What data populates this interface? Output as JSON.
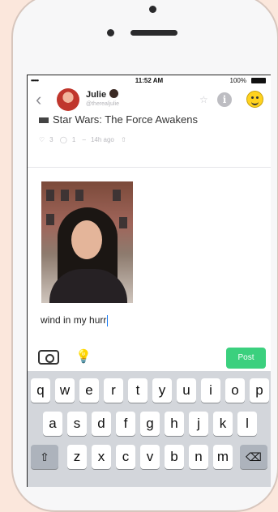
{
  "status": {
    "signal": "••••• ",
    "time": "11:52 AM",
    "battery": "100%"
  },
  "nav": {
    "back": "‹",
    "name": "Julie",
    "handle": "@therealjulie",
    "star": "☆",
    "info": "i"
  },
  "previous_post": {
    "title": "Star Wars: The Force Awakens",
    "likes": "3",
    "comments": "1",
    "time": "14h ago"
  },
  "compose": {
    "caption": "wind in my hurr"
  },
  "toolbar": {
    "bulb": "💡",
    "post_label": "Post"
  },
  "keyboard": {
    "row1": [
      "q",
      "w",
      "e",
      "r",
      "t",
      "y",
      "u",
      "i",
      "o",
      "p"
    ],
    "row2": [
      "a",
      "s",
      "d",
      "f",
      "g",
      "h",
      "j",
      "k",
      "l"
    ],
    "row3": [
      "z",
      "x",
      "c",
      "v",
      "b",
      "n",
      "m"
    ],
    "shift": "⇧",
    "delete": "⌫"
  },
  "colors": {
    "accent": "#3bd07e",
    "background": "#fbe7dc"
  }
}
